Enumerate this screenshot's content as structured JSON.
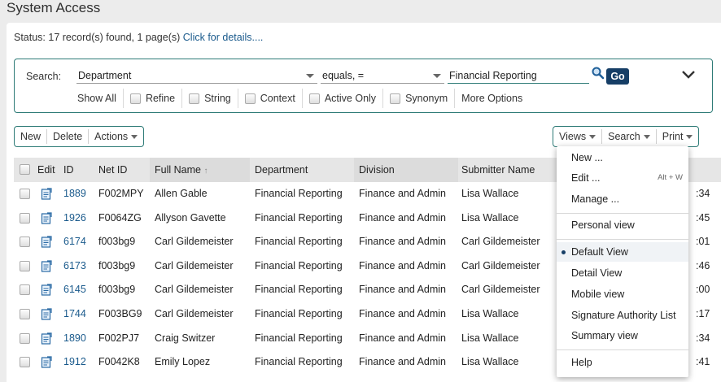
{
  "page": {
    "title": "System Access"
  },
  "status": {
    "text": "Status: 17 record(s) found, 1 page(s)",
    "link": "Click for details...."
  },
  "search": {
    "label": "Search:",
    "field": "Department",
    "operator": "equals, =",
    "value": "Financial Reporting",
    "go_label": "Go",
    "options": {
      "show_all": "Show All",
      "refine": "Refine",
      "string": "String",
      "context": "Context",
      "active_only": "Active Only",
      "synonym": "Synonym",
      "more_options": "More Options"
    }
  },
  "toolbar": {
    "new_label": "New",
    "delete_label": "Delete",
    "actions_label": "Actions",
    "views_label": "Views",
    "search_label": "Search",
    "print_label": "Print"
  },
  "table": {
    "headers": {
      "edit": "Edit",
      "id": "ID",
      "net_id": "Net ID",
      "full_name": "Full Name",
      "department": "Department",
      "division": "Division",
      "submitter": "Submitter Name"
    },
    "rows": [
      {
        "id": "1889",
        "net_id": "F002MPY",
        "full_name": "Allen Gable",
        "department": "Financial Reporting",
        "division": "Finance and Admin",
        "submitter": "Lisa Wallace",
        "tail": ":34"
      },
      {
        "id": "1926",
        "net_id": "F0064ZG",
        "full_name": "Allyson Gavette",
        "department": "Financial Reporting",
        "division": "Finance and Admin",
        "submitter": "Lisa Wallace",
        "tail": ":45"
      },
      {
        "id": "6174",
        "net_id": "f003bg9",
        "full_name": "Carl Gildemeister",
        "department": "Financial Reporting",
        "division": "Finance and Admin",
        "submitter": "Carl Gildemeister",
        "tail": ":01"
      },
      {
        "id": "6173",
        "net_id": "f003bg9",
        "full_name": "Carl Gildemeister",
        "department": "Financial Reporting",
        "division": "Finance and Admin",
        "submitter": "Carl Gildemeister",
        "tail": ":46"
      },
      {
        "id": "6145",
        "net_id": "f003bg9",
        "full_name": "Carl Gildemeister",
        "department": "Financial Reporting",
        "division": "Finance and Admin",
        "submitter": "Carl Gildemeister",
        "tail": ":00"
      },
      {
        "id": "1744",
        "net_id": "F003BG9",
        "full_name": "Carl Gildemeister",
        "department": "Financial Reporting",
        "division": "Finance and Admin",
        "submitter": "Lisa Wallace",
        "tail": ":17"
      },
      {
        "id": "1890",
        "net_id": "F002PJ7",
        "full_name": "Craig Switzer",
        "department": "Financial Reporting",
        "division": "Finance and Admin",
        "submitter": "Lisa Wallace",
        "tail": ":34"
      },
      {
        "id": "1912",
        "net_id": "F0042K8",
        "full_name": "Emily Lopez",
        "department": "Financial Reporting",
        "division": "Finance and Admin",
        "submitter": "Lisa Wallace",
        "tail": ":41"
      }
    ]
  },
  "views_menu": {
    "items": [
      {
        "label": "New ...",
        "shortcut": ""
      },
      {
        "label": "Edit ...",
        "shortcut": "Alt + W"
      },
      {
        "label": "Manage ...",
        "shortcut": ""
      },
      {
        "label": "Personal view",
        "shortcut": ""
      },
      {
        "label": "Default View",
        "shortcut": "",
        "selected": true
      },
      {
        "label": "Detail View",
        "shortcut": ""
      },
      {
        "label": "Mobile view",
        "shortcut": ""
      },
      {
        "label": "Signature Authority List",
        "shortcut": ""
      },
      {
        "label": "Summary view",
        "shortcut": ""
      },
      {
        "label": "Help",
        "shortcut": ""
      }
    ]
  },
  "colors": {
    "accent": "#2e7b77",
    "button_dark": "#163e66",
    "link": "#1a5a8c"
  }
}
